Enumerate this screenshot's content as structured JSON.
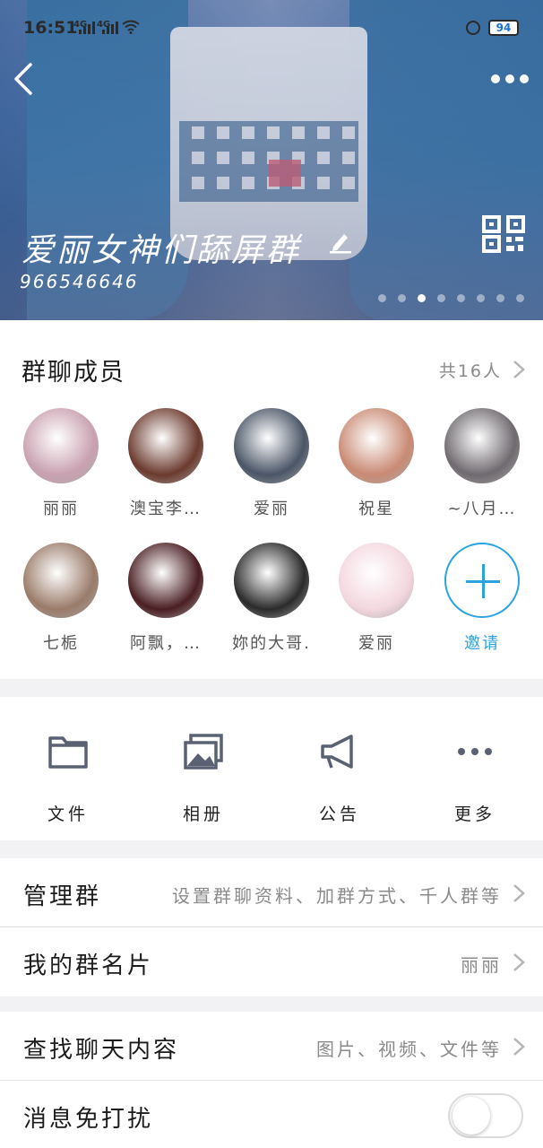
{
  "status_bar": {
    "time": "16:51",
    "signal1": "4G",
    "signal2": "4G",
    "battery": "94"
  },
  "header": {
    "group_name": "爱丽女神们舔屏群",
    "group_id": "966546646",
    "page_dots": 8,
    "active_dot": 3
  },
  "members": {
    "title": "群聊成员",
    "count": "共16人",
    "items": [
      {
        "name": "丽丽",
        "color": "#c9a1b0"
      },
      {
        "name": "澳宝李…",
        "color": "#6b3a2e"
      },
      {
        "name": "爱丽",
        "color": "#4a5566"
      },
      {
        "name": "祝星",
        "color": "#c98a74"
      },
      {
        "name": "~八月…",
        "color": "#6f6a6f"
      },
      {
        "name": "七栀",
        "color": "#9a7b6a"
      },
      {
        "name": "阿飘，…",
        "color": "#4a1e22"
      },
      {
        "name": "妳的大哥.",
        "color": "#2b2b2b"
      },
      {
        "name": "爱丽",
        "color": "#f3d7df"
      }
    ],
    "invite_label": "邀请"
  },
  "actions": {
    "files": "文件",
    "album": "相册",
    "notice": "公告",
    "more": "更多"
  },
  "settings": {
    "manage": {
      "label": "管理群",
      "value": "设置群聊资料、加群方式、千人群等"
    },
    "card": {
      "label": "我的群名片",
      "value": "丽丽"
    },
    "search": {
      "label": "查找聊天内容",
      "value": "图片、视频、文件等"
    },
    "mute": {
      "label": "消息免打扰",
      "enabled": false
    }
  },
  "colors": {
    "accent": "#2aa3e0",
    "icon_gray": "#5a6173",
    "divider": "#e3e3e6"
  }
}
